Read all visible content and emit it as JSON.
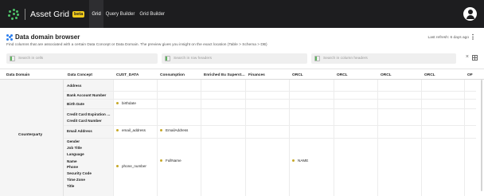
{
  "app": {
    "title": "Asset Grid",
    "badge": "beta",
    "nav": [
      "Grid",
      "Query Builder",
      "Grid Builder"
    ],
    "active_nav": "Grid",
    "logo_icon": "asset-grid-logo",
    "avatar_icon": "user-icon"
  },
  "header": {
    "title": "Data domain browser",
    "description": "Find columns that are associated with a certain Data Concept or Data Domain. The preview gives you insight on the exact location (Table > Schema > DB)",
    "last_refresh": "Last refresh: 6 days ago",
    "more_icon": "⋮"
  },
  "filters": {
    "cells_placeholder": "Search in cells",
    "rows_placeholder": "Search in row headers",
    "columns_placeholder": "Search in column headers",
    "clear": "×"
  },
  "table": {
    "columns": [
      "Data Domain",
      "Data Concept",
      "CUST_DATA",
      "Consumption",
      "Enriched Eu Superst…",
      "Finances",
      "ORCL",
      "ORCL",
      "ORCL",
      "ORCL",
      "OF"
    ],
    "domain": "Counterparty",
    "concepts": [
      "Address",
      "Bank Account Number",
      "Birth Date",
      "Credit Card Expiration …",
      "Credit Card Number",
      "Email Address",
      "Gender",
      "Job Title",
      "Language",
      "Name",
      "Phone",
      "Security Code",
      "Time Zone",
      "Title"
    ],
    "values": {
      "birth_date_cust": "birthdate",
      "email_cust": "email_address",
      "email_consumption": "EmailAddress",
      "name_consumption": "FullName",
      "name_orcl": "NAME",
      "phone_cust": "phone_number"
    },
    "dot_color": "#c6a827"
  }
}
